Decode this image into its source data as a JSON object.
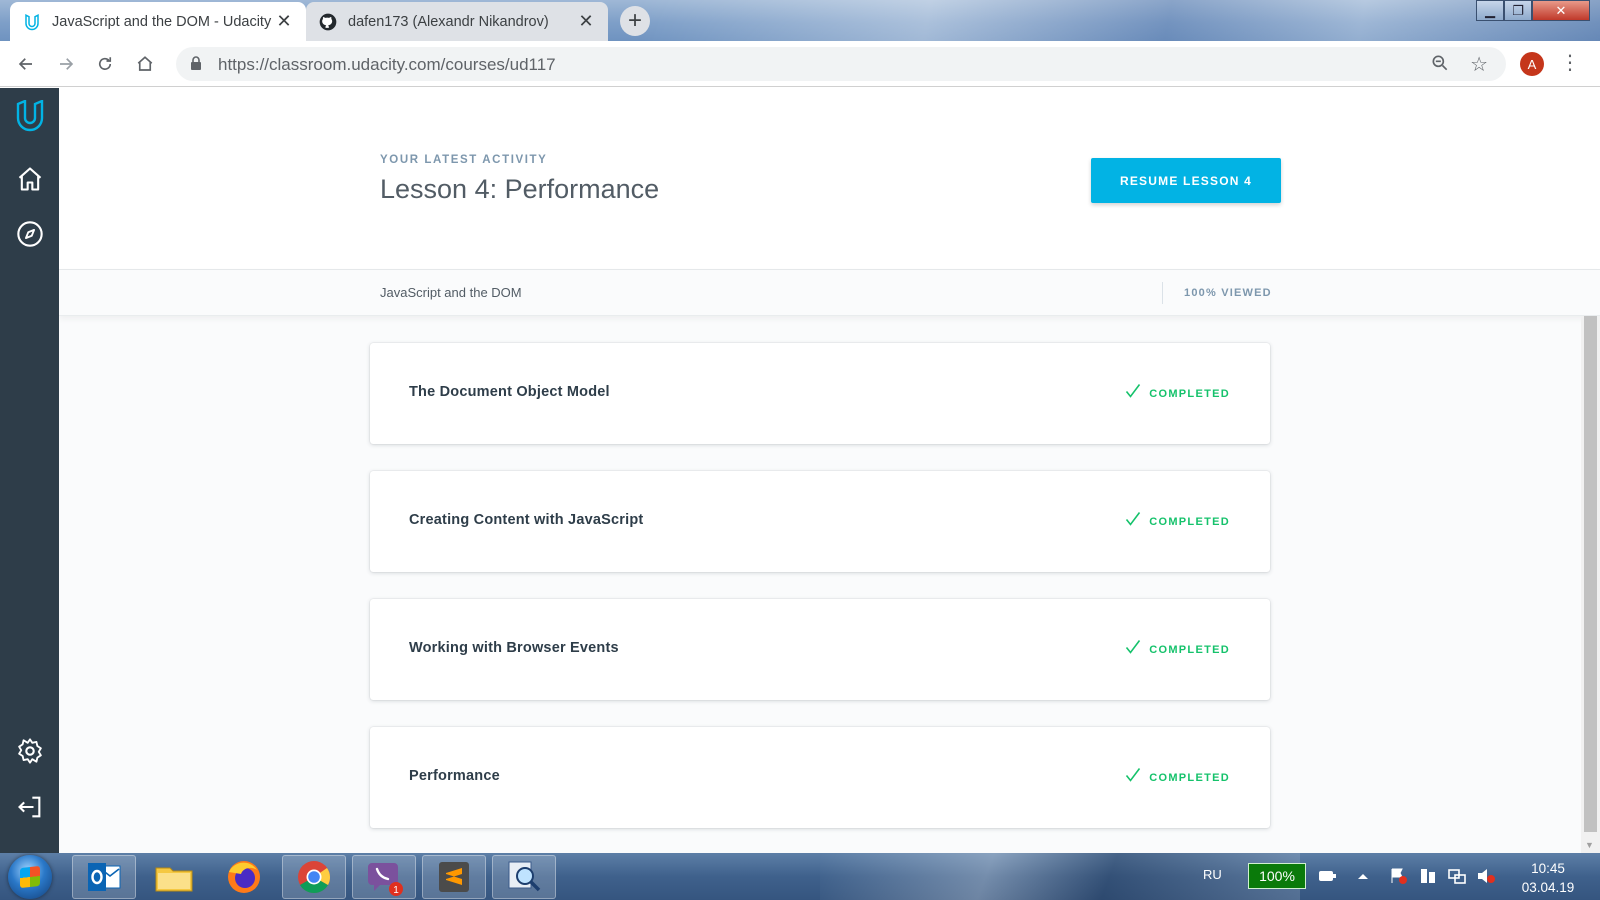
{
  "browser": {
    "tabs": [
      {
        "title": "JavaScript and the DOM - Udacity",
        "active": true,
        "favicon": "udacity-icon"
      },
      {
        "title": "dafen173 (Alexandr Nikandrov)",
        "active": false,
        "favicon": "github-icon"
      }
    ],
    "url_host": "https://classroom.udacity.com",
    "url_path": "/courses/ud117",
    "profile_initial": "A",
    "window_controls": {
      "minimize": "minimize-icon",
      "maximize": "maximize-icon",
      "close": "close-icon"
    }
  },
  "rail": {
    "items": [
      "udacity-logo-icon",
      "home-icon",
      "compass-icon",
      "settings-icon",
      "logout-icon"
    ]
  },
  "hero": {
    "eyebrow": "YOUR LATEST ACTIVITY",
    "title": "Lesson 4: Performance",
    "resume_label": "RESUME LESSON 4"
  },
  "subbar": {
    "course_name": "JavaScript and the DOM",
    "progress_label": "100% VIEWED",
    "progress_fraction": 1.0
  },
  "lessons": [
    {
      "title": "The Document Object Model",
      "status": "COMPLETED"
    },
    {
      "title": "Creating Content with JavaScript",
      "status": "COMPLETED"
    },
    {
      "title": "Working with Browser Events",
      "status": "COMPLETED"
    },
    {
      "title": "Performance",
      "status": "COMPLETED"
    }
  ],
  "taskbar": {
    "apps": [
      "outlook-icon",
      "file-explorer-icon",
      "firefox-icon",
      "chrome-icon",
      "viber-icon",
      "sublime-text-icon",
      "search-tool-icon"
    ],
    "viber_badge": "1",
    "language": "RU",
    "battery": "100%",
    "time": "10:45",
    "date": "03.04.19"
  },
  "colors": {
    "accent": "#02b3e4",
    "rail": "#2e3d49",
    "completed": "#15c26b",
    "muted": "#7d97ad"
  }
}
